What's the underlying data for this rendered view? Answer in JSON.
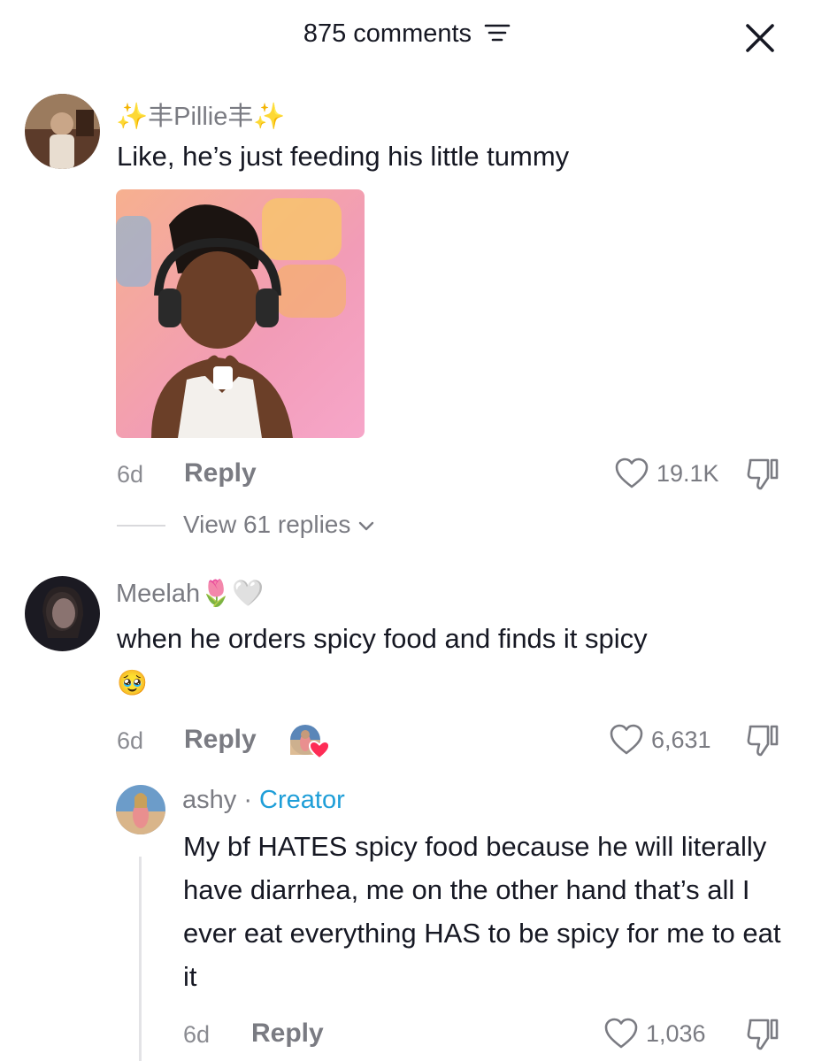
{
  "header": {
    "comment_count": "875 comments"
  },
  "comments": [
    {
      "username": "✨丰Pillie丰✨",
      "text": "Like, he’s just feeding his little tummy",
      "age": "6d",
      "reply_label": "Reply",
      "likes": "19.1K",
      "view_replies": "View 61 replies"
    },
    {
      "username": "Meelah",
      "username_emoji": "🌷🤍",
      "text": "when he orders spicy food and finds it spicy",
      "emoji_line": "🥹",
      "age": "6d",
      "reply_label": "Reply",
      "likes": "6,631"
    }
  ],
  "reply": {
    "username": "ashy",
    "separator": " · ",
    "badge": "Creator",
    "text": "My bf HATES spicy food because he will literally have diarrhea, me on the other hand that’s all I ever eat everything HAS to be spicy for me to eat it",
    "age": "6d",
    "reply_label": "Reply",
    "likes": "1,036"
  },
  "colors": {
    "accent_creator": "#1e9ed8",
    "secondary_text": "#7a7b82",
    "heart_badge": "#fe2c55"
  }
}
